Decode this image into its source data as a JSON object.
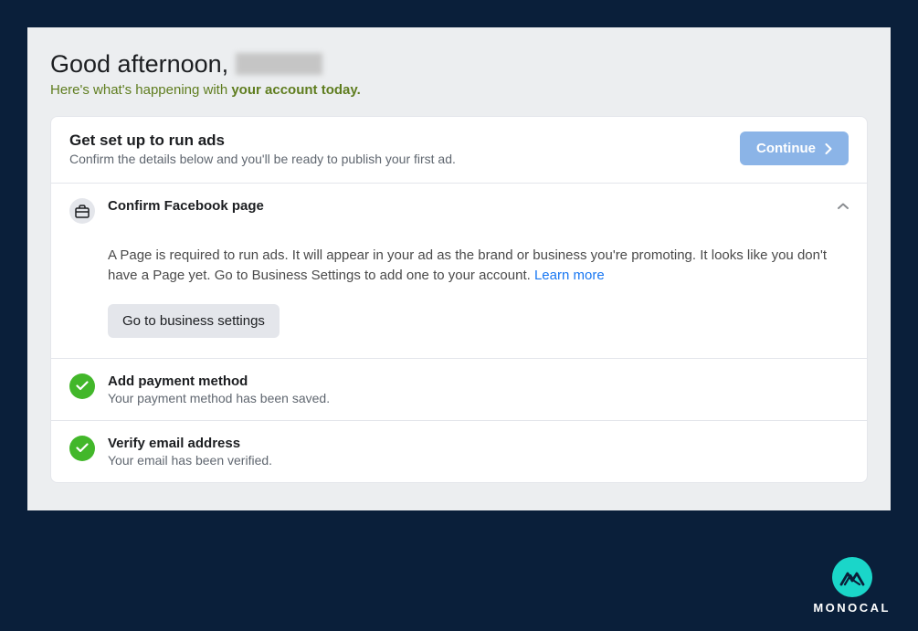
{
  "greeting": {
    "prefix": "Good afternoon, ",
    "sub_prefix": "Here's what's happening with ",
    "sub_strong": "your account today."
  },
  "setup": {
    "title": "Get set up to run ads",
    "subtitle": "Confirm the details below and you'll be ready to publish your first ad.",
    "continue_label": "Continue"
  },
  "step1": {
    "title": "Confirm Facebook page",
    "body": "A Page is required to run ads. It will appear in your ad as the brand or business you're promoting. It looks like you don't have a Page yet. Go to Business Settings to add one to your account. ",
    "learn_more": "Learn more",
    "cta": "Go to business settings"
  },
  "step2": {
    "title": "Add payment method",
    "desc": "Your payment method has been saved."
  },
  "step3": {
    "title": "Verify email address",
    "desc": "Your email has been verified."
  },
  "brand": {
    "name": "MONOCAL"
  }
}
